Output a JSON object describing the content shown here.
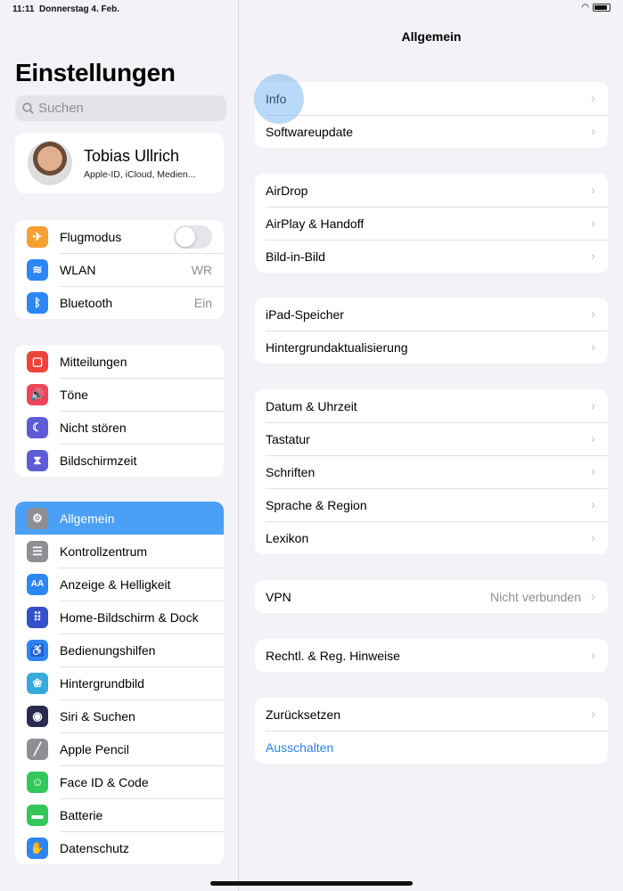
{
  "status": {
    "time": "11:11",
    "date": "Donnerstag 4. Feb."
  },
  "sidebar": {
    "title": "Einstellungen",
    "search_placeholder": "Suchen",
    "profile": {
      "name": "Tobias Ullrich",
      "subtitle": "Apple-ID, iCloud, Medien..."
    },
    "groups": [
      [
        {
          "label": "Flugmodus",
          "icon": "airplane-icon",
          "color": "#f7a032",
          "glyph": "✈",
          "toggle": false
        },
        {
          "label": "WLAN",
          "icon": "wifi-icon",
          "color": "#2d86f4",
          "glyph": "≋",
          "value": "WR"
        },
        {
          "label": "Bluetooth",
          "icon": "bluetooth-icon",
          "color": "#2d86f4",
          "glyph": "ᛒ",
          "value": "Ein"
        }
      ],
      [
        {
          "label": "Mitteilungen",
          "icon": "notifications-icon",
          "color": "#f0443a",
          "glyph": "▢"
        },
        {
          "label": "Töne",
          "icon": "sound-icon",
          "color": "#f0445a",
          "glyph": "🔊"
        },
        {
          "label": "Nicht stören",
          "icon": "moon-icon",
          "color": "#5d5bd6",
          "glyph": "☾"
        },
        {
          "label": "Bildschirmzeit",
          "icon": "hourglass-icon",
          "color": "#5d5bd6",
          "glyph": "⧗"
        }
      ],
      [
        {
          "label": "Allgemein",
          "icon": "gear-icon",
          "color": "#8e8e93",
          "glyph": "⚙",
          "selected": true
        },
        {
          "label": "Kontrollzentrum",
          "icon": "switches-icon",
          "color": "#8e8e93",
          "glyph": "☰"
        },
        {
          "label": "Anzeige & Helligkeit",
          "icon": "text-size-icon",
          "color": "#2d86f4",
          "glyph": "AA"
        },
        {
          "label": "Home-Bildschirm & Dock",
          "icon": "home-screen-icon",
          "color": "#3350c8",
          "glyph": "⠿"
        },
        {
          "label": "Bedienungshilfen",
          "icon": "accessibility-icon",
          "color": "#2d86f4",
          "glyph": "♿"
        },
        {
          "label": "Hintergrundbild",
          "icon": "wallpaper-icon",
          "color": "#35aadc",
          "glyph": "❀"
        },
        {
          "label": "Siri & Suchen",
          "icon": "siri-icon",
          "color": "#2a2a50",
          "glyph": "◉"
        },
        {
          "label": "Apple Pencil",
          "icon": "pencil-icon",
          "color": "#8e8e93",
          "glyph": "╱"
        },
        {
          "label": "Face ID & Code",
          "icon": "face-id-icon",
          "color": "#34c759",
          "glyph": "☺"
        },
        {
          "label": "Batterie",
          "icon": "battery-icon",
          "color": "#34c759",
          "glyph": "▬"
        },
        {
          "label": "Datenschutz",
          "icon": "hand-icon",
          "color": "#2d86f4",
          "glyph": "✋"
        }
      ]
    ]
  },
  "main": {
    "title": "Allgemein",
    "groups": [
      [
        {
          "label": "Info"
        },
        {
          "label": "Softwareupdate"
        }
      ],
      [
        {
          "label": "AirDrop"
        },
        {
          "label": "AirPlay & Handoff"
        },
        {
          "label": "Bild-in-Bild"
        }
      ],
      [
        {
          "label": "iPad-Speicher"
        },
        {
          "label": "Hintergrundaktualisierung"
        }
      ],
      [
        {
          "label": "Datum & Uhrzeit"
        },
        {
          "label": "Tastatur"
        },
        {
          "label": "Schriften"
        },
        {
          "label": "Sprache & Region"
        },
        {
          "label": "Lexikon"
        }
      ],
      [
        {
          "label": "VPN",
          "value": "Nicht verbunden"
        }
      ],
      [
        {
          "label": "Rechtl. & Reg. Hinweise"
        }
      ],
      [
        {
          "label": "Zurücksetzen"
        },
        {
          "label": "Ausschalten",
          "action": true,
          "color": "#2a84e8"
        }
      ]
    ]
  }
}
